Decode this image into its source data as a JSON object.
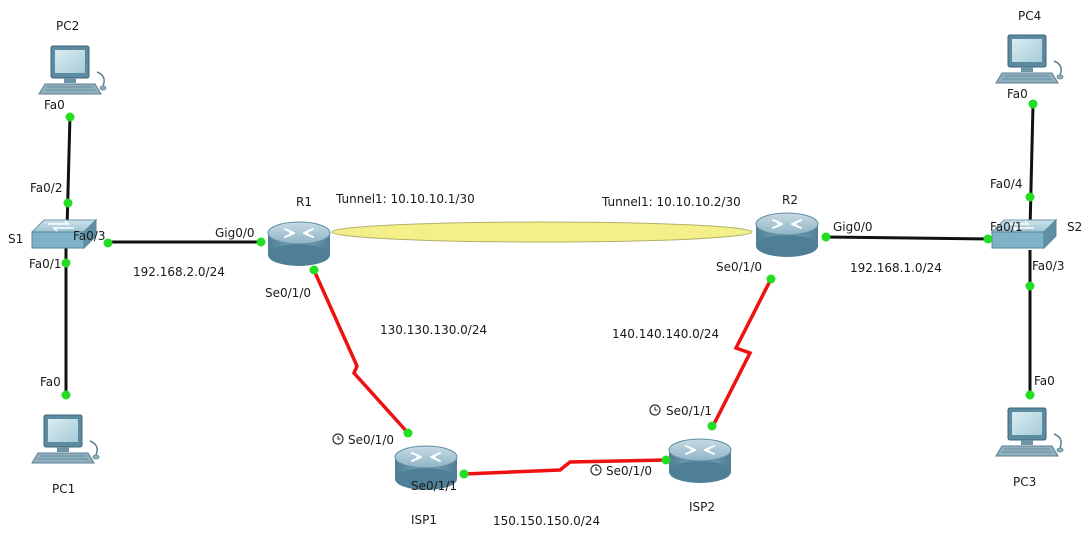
{
  "devices": {
    "pc1": "PC1",
    "pc2": "PC2",
    "pc3": "PC3",
    "pc4": "PC4",
    "s1": "S1",
    "s2": "S2",
    "r1": "R1",
    "r2": "R2",
    "isp1": "ISP1",
    "isp2": "ISP2"
  },
  "ports": {
    "pc2_fa0": "Fa0",
    "s1_fa02": "Fa0/2",
    "s1_fa03": "Fa0/3",
    "s1_fa01": "Fa0/1",
    "pc1_fa0": "Fa0",
    "r1_gig00": "Gig0/0",
    "r1_se010": "Se0/1/0",
    "isp1_se010": "Se0/1/0",
    "isp1_se011": "Se0/1/1",
    "isp2_se010": "Se0/1/0",
    "isp2_se011": "Se0/1/1",
    "r2_se010": "Se0/1/0",
    "r2_gig00": "Gig0/0",
    "s2_fa01": "Fa0/1",
    "s2_fa04": "Fa0/4",
    "s2_fa03": "Fa0/3",
    "pc4_fa0": "Fa0",
    "pc3_fa0": "Fa0"
  },
  "networks": {
    "lan1": "192.168.2.0/24",
    "lan2": "192.168.1.0/24",
    "wan1": "130.130.130.0/24",
    "wan2": "140.140.140.0/24",
    "wan3": "150.150.150.0/24"
  },
  "tunnel": {
    "r1": "Tunnel1: 10.10.10.1/30",
    "r2": "Tunnel1: 10.10.10.2/30"
  },
  "colors": {
    "ethernet": "#111111",
    "serial": "#ee1111",
    "port_up": "#22dd22",
    "tunnel_fill": "#f3f08a",
    "router": "#7fa8bb",
    "switch": "#7fb2c6",
    "pc": "#2d5f7a"
  }
}
